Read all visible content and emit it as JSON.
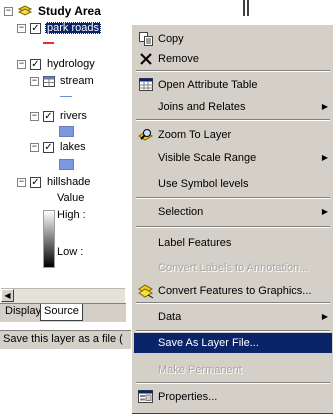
{
  "toc": {
    "study_area": "Study Area",
    "park_roads": "park roads",
    "hydrology": "hydrology",
    "streams": "stream",
    "rivers": "rivers",
    "lakes": "lakes",
    "hillshade": "hillshade",
    "value_label": "Value",
    "high_label": "High :",
    "low_label": "Low :",
    "expand_glyph": "−",
    "check_glyph": "✓",
    "scroll_left": "◀"
  },
  "colors": {
    "selection": "#0a246a",
    "park_roads_line": "#e8302a",
    "stream_line": "#6e8fd6",
    "water_fill": "#7b98e0"
  },
  "tabs": {
    "display": "Display",
    "source": "Source"
  },
  "status_bar": {
    "text": "Save this layer as a file ("
  },
  "context_menu": {
    "submenu_arrow": "▶",
    "items": [
      {
        "label": "Copy",
        "icon": "copy-icon"
      },
      {
        "label": "Remove",
        "icon": "remove-icon"
      },
      {
        "label": "Open Attribute Table",
        "icon": "table-icon"
      },
      {
        "label": "Joins and Relates",
        "submenu": true
      },
      {
        "label": "Zoom To Layer",
        "icon": "zoom-layer-icon"
      },
      {
        "label": "Visible Scale Range",
        "submenu": true
      },
      {
        "label": "Use Symbol levels"
      },
      {
        "label": "Selection",
        "submenu": true
      },
      {
        "label": "Label Features"
      },
      {
        "label": "Convert Labels to Annotation...",
        "disabled": true
      },
      {
        "label": "Convert Features to Graphics...",
        "icon": "convert-graphics-icon"
      },
      {
        "label": "Data",
        "submenu": true
      },
      {
        "label": "Save As Layer File...",
        "highlighted": true
      },
      {
        "label": "Make Permanent",
        "disabled": true
      },
      {
        "label": "Properties...",
        "icon": "properties-icon"
      }
    ]
  }
}
